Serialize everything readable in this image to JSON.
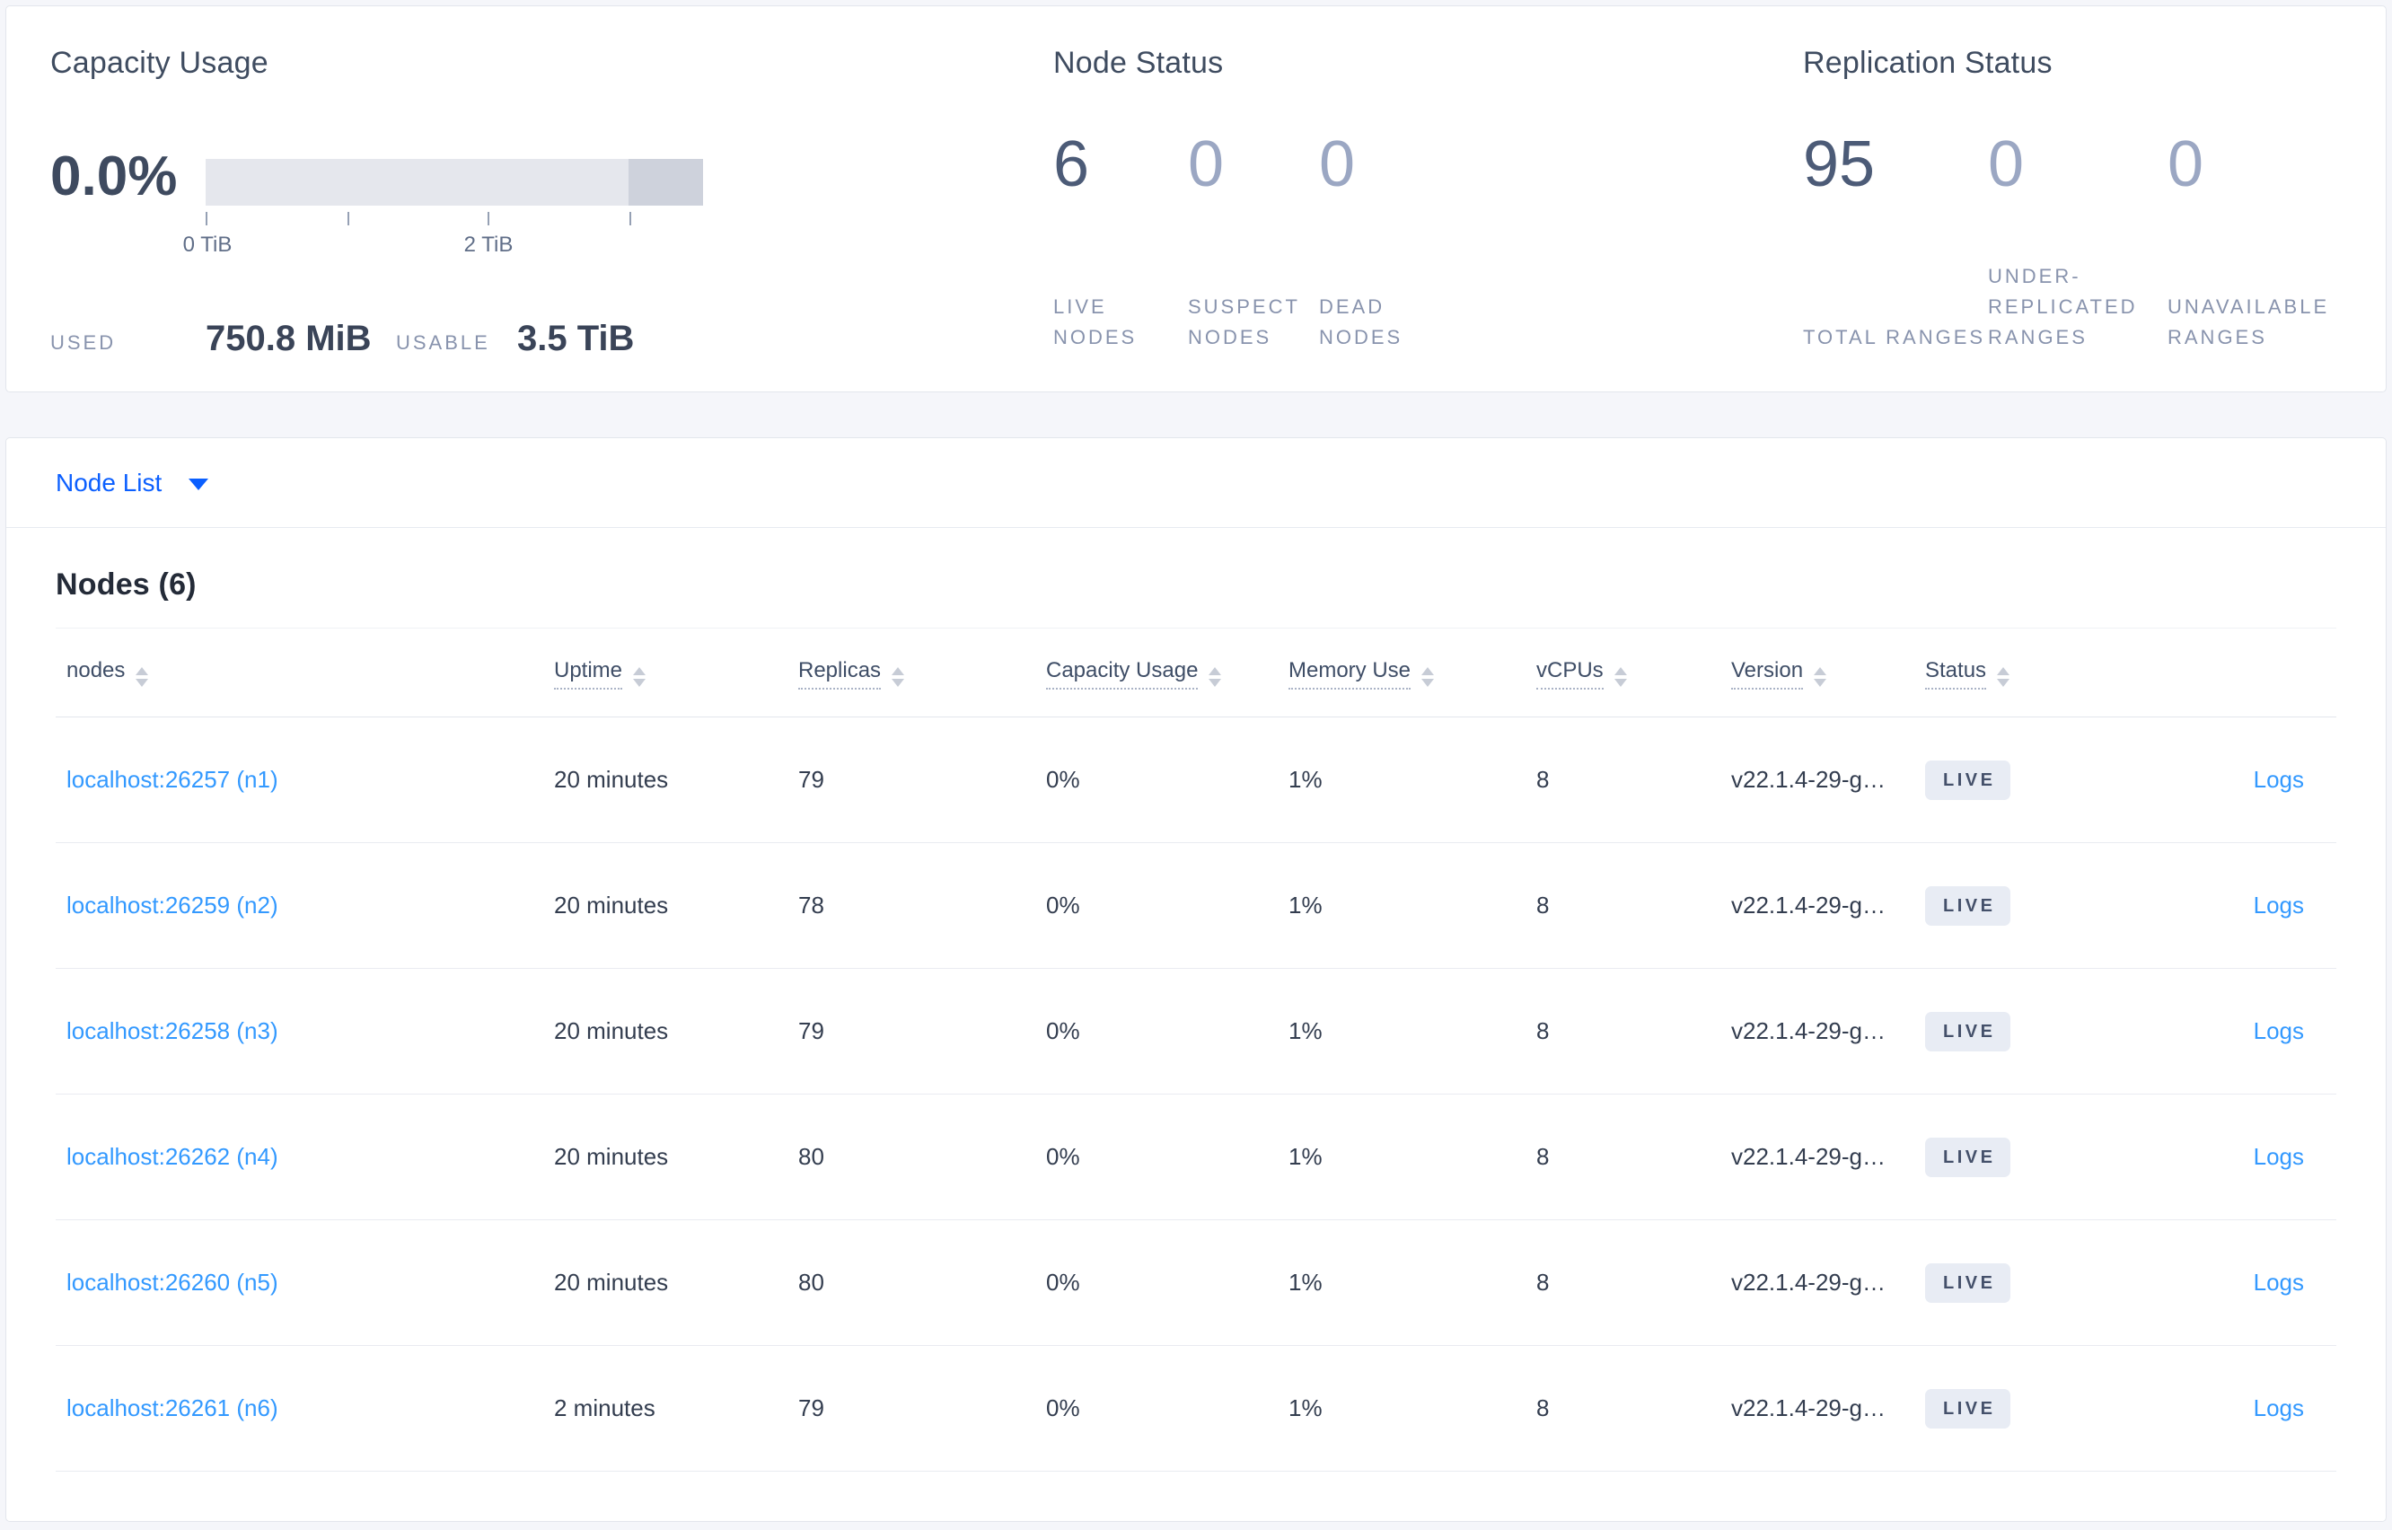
{
  "summary": {
    "capacity": {
      "title": "Capacity Usage",
      "percent": "0.0%",
      "tick_labels": [
        "0 TiB",
        "2 TiB"
      ],
      "used_label": "USED",
      "used_value": "750.8 MiB",
      "usable_label": "USABLE",
      "usable_value": "3.5 TiB",
      "bar_light_color": "#e5e7ed",
      "bar_dark_color": "#ced2dc",
      "bar_dark_segment_start_pct": 85
    },
    "node_status": {
      "title": "Node Status",
      "metrics": [
        {
          "value": "6",
          "label": "LIVE NODES"
        },
        {
          "value": "0",
          "label": "SUSPECT NODES"
        },
        {
          "value": "0",
          "label": "DEAD NODES"
        }
      ]
    },
    "replication_status": {
      "title": "Replication Status",
      "metrics": [
        {
          "value": "95",
          "label": "TOTAL RANGES"
        },
        {
          "value": "0",
          "label": "UNDER-REPLICATED RANGES"
        },
        {
          "value": "0",
          "label": "UNAVAILABLE RANGES"
        }
      ]
    }
  },
  "view_selector": {
    "label": "Node List",
    "icon": "caret-down-icon"
  },
  "nodes_table": {
    "title": "Nodes (6)",
    "columns": [
      {
        "key": "address",
        "label": "nodes",
        "sortable": true,
        "underlined": false
      },
      {
        "key": "uptime",
        "label": "Uptime",
        "sortable": true,
        "underlined": true
      },
      {
        "key": "replicas",
        "label": "Replicas",
        "sortable": true,
        "underlined": true
      },
      {
        "key": "capacity",
        "label": "Capacity Usage",
        "sortable": true,
        "underlined": true
      },
      {
        "key": "memory",
        "label": "Memory Use",
        "sortable": true,
        "underlined": true
      },
      {
        "key": "vcpus",
        "label": "vCPUs",
        "sortable": true,
        "underlined": true
      },
      {
        "key": "version",
        "label": "Version",
        "sortable": true,
        "underlined": true
      },
      {
        "key": "status",
        "label": "Status",
        "sortable": true,
        "underlined": true
      },
      {
        "key": "logs",
        "label": "",
        "sortable": false,
        "underlined": false
      }
    ],
    "rows": [
      {
        "address": "localhost:26257 (n1)",
        "uptime": "20 minutes",
        "replicas": "79",
        "capacity": "0%",
        "memory": "1%",
        "vcpus": "8",
        "version": "v22.1.4-29-g…",
        "status": "LIVE",
        "logs": "Logs"
      },
      {
        "address": "localhost:26259 (n2)",
        "uptime": "20 minutes",
        "replicas": "78",
        "capacity": "0%",
        "memory": "1%",
        "vcpus": "8",
        "version": "v22.1.4-29-g…",
        "status": "LIVE",
        "logs": "Logs"
      },
      {
        "address": "localhost:26258 (n3)",
        "uptime": "20 minutes",
        "replicas": "79",
        "capacity": "0%",
        "memory": "1%",
        "vcpus": "8",
        "version": "v22.1.4-29-g…",
        "status": "LIVE",
        "logs": "Logs"
      },
      {
        "address": "localhost:26262 (n4)",
        "uptime": "20 minutes",
        "replicas": "80",
        "capacity": "0%",
        "memory": "1%",
        "vcpus": "8",
        "version": "v22.1.4-29-g…",
        "status": "LIVE",
        "logs": "Logs"
      },
      {
        "address": "localhost:26260 (n5)",
        "uptime": "20 minutes",
        "replicas": "80",
        "capacity": "0%",
        "memory": "1%",
        "vcpus": "8",
        "version": "v22.1.4-29-g…",
        "status": "LIVE",
        "logs": "Logs"
      },
      {
        "address": "localhost:26261 (n6)",
        "uptime": "2 minutes",
        "replicas": "79",
        "capacity": "0%",
        "memory": "1%",
        "vcpus": "8",
        "version": "v22.1.4-29-g…",
        "status": "LIVE",
        "logs": "Logs"
      }
    ]
  },
  "colors": {
    "selector_blue": "#0b5fff",
    "link_blue": "#3399ff",
    "badge_bg": "#e8ecf4",
    "badge_text": "#44506a"
  }
}
